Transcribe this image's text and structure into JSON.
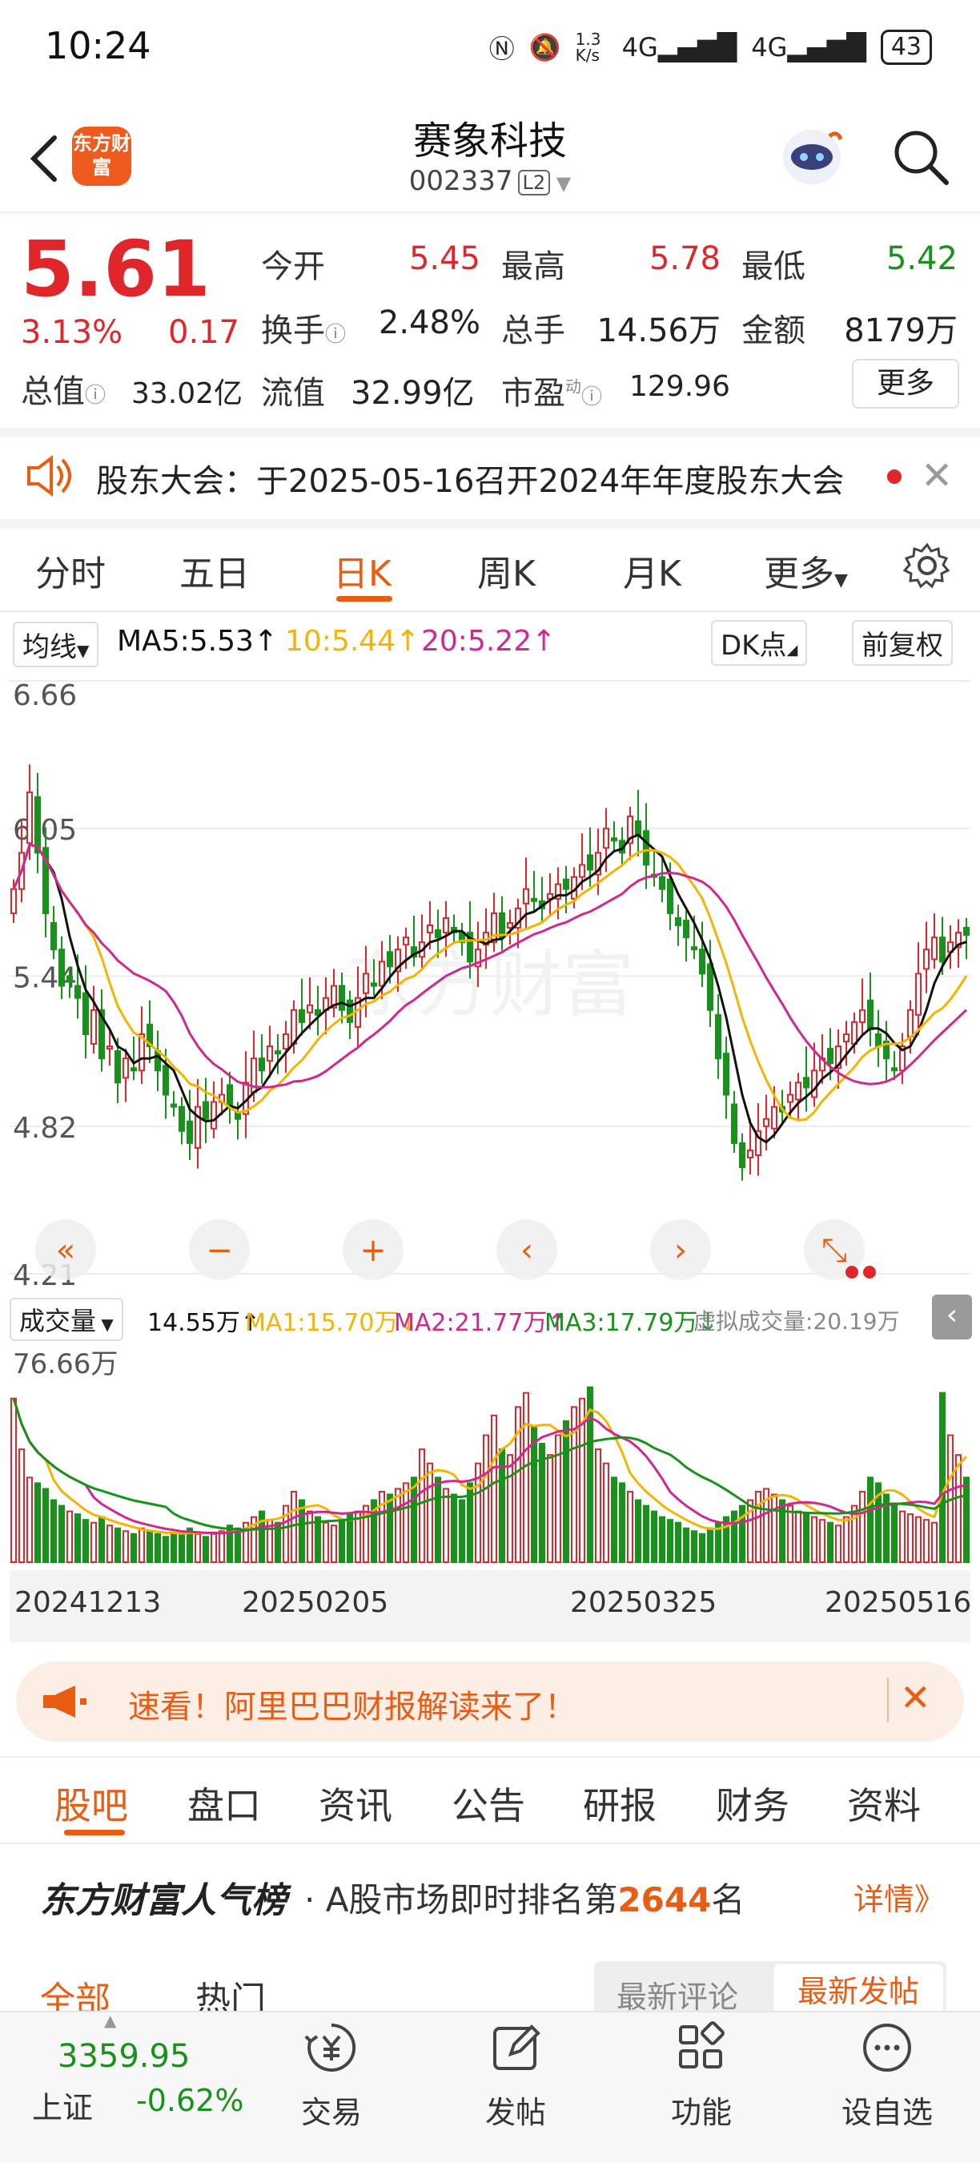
{
  "status_bar": {
    "time": "10:24",
    "net_speed": "1.3 K/s",
    "signal1": "4G",
    "signal2": "4G",
    "battery": "43"
  },
  "header": {
    "logo_text": "东方财富",
    "stock_name": "赛象科技",
    "stock_code": "002337",
    "level_badge": "L2"
  },
  "quote": {
    "price": "5.61",
    "change_pct": "3.13%",
    "change_abs": "0.17",
    "open_label": "今开",
    "open": "5.45",
    "high_label": "最高",
    "high": "5.78",
    "low_label": "最低",
    "low": "5.42",
    "turnover_label": "换手",
    "turnover": "2.48%",
    "volume_label": "总手",
    "volume": "14.56万",
    "amount_label": "金额",
    "amount": "8179万",
    "mktcap_label": "总值",
    "mktcap": "33.02亿",
    "float_label": "流值",
    "float_cap": "32.99亿",
    "pe_label": "市盈",
    "pe_sup": "动",
    "pe": "129.96",
    "more": "更多"
  },
  "notice": {
    "text": "股东大会：于2025-05-16召开2024年年度股东大会"
  },
  "period_tabs": [
    "分时",
    "五日",
    "日K",
    "周K",
    "月K",
    "更多"
  ],
  "ma_bar": {
    "ma_select": "均线",
    "ma5": "MA5:5.53↑",
    "ma10": "10:5.44↑",
    "ma20": "20:5.22↑",
    "dk": "DK点",
    "adjust": "前复权"
  },
  "volume_bar": {
    "select": "成交量",
    "vol": "14.55万↑",
    "ma1": "MA1:15.70万↓",
    "ma2": "MA2:21.77万↑",
    "ma3": "MA3:17.79万↓",
    "virtual": "虚拟成交量:20.19万"
  },
  "chart_data": {
    "type": "candlestick",
    "price_axis_labels": [
      "6.66",
      "6.05",
      "5.44",
      "4.82",
      "4.21"
    ],
    "ylim": [
      4.21,
      6.66
    ],
    "volume_axis_label": "76.66万",
    "volume_ylim": [
      0,
      76.66
    ],
    "date_labels": [
      "20241213",
      "20250205",
      "20250325",
      "20250516"
    ],
    "series_colors": {
      "ma5": "#111111",
      "ma10": "#f5b400",
      "ma20": "#d0288f",
      "up": "#e0262b",
      "down": "#17931b",
      "vol_ma3": "#17931b"
    },
    "closes": [
      5.8,
      5.95,
      6.2,
      5.95,
      5.7,
      5.55,
      5.4,
      5.42,
      5.35,
      5.2,
      5.3,
      5.1,
      5.15,
      5.0,
      5.1,
      5.05,
      5.2,
      5.15,
      5.05,
      4.95,
      4.9,
      4.8,
      4.75,
      4.9,
      4.85,
      4.92,
      4.95,
      4.9,
      4.85,
      5.0,
      5.1,
      5.05,
      5.15,
      5.12,
      5.2,
      5.3,
      5.25,
      5.32,
      5.28,
      5.35,
      5.4,
      5.3,
      5.25,
      5.35,
      5.45,
      5.4,
      5.5,
      5.48,
      5.55,
      5.6,
      5.52,
      5.58,
      5.65,
      5.6,
      5.68,
      5.62,
      5.58,
      5.5,
      5.55,
      5.62,
      5.7,
      5.6,
      5.66,
      5.72,
      5.8,
      5.75,
      5.72,
      5.78,
      5.82,
      5.8,
      5.85,
      5.9,
      5.88,
      5.95,
      6.05,
      6.0,
      5.95,
      6.1,
      6.02,
      5.9,
      5.85,
      5.8,
      5.7,
      5.65,
      5.6,
      5.55,
      5.45,
      5.3,
      5.1,
      4.95,
      4.75,
      4.65,
      4.72,
      4.8,
      4.85,
      4.9,
      4.88,
      4.95,
      5.0,
      4.98,
      5.05,
      5.1,
      5.08,
      5.15,
      5.2,
      5.25,
      5.3,
      5.22,
      5.15,
      5.1,
      5.05,
      5.15,
      5.3,
      5.45,
      5.55,
      5.6,
      5.5,
      5.58,
      5.62,
      5.61
    ],
    "volumes": [
      58,
      40,
      30,
      28,
      26,
      22,
      20,
      18,
      17,
      15,
      14,
      16,
      13,
      12,
      11,
      10,
      12,
      11,
      10,
      9,
      10,
      11,
      12,
      10,
      9,
      10,
      11,
      13,
      12,
      14,
      16,
      18,
      15,
      14,
      20,
      25,
      22,
      18,
      16,
      14,
      13,
      15,
      17,
      18,
      20,
      22,
      25,
      24,
      26,
      28,
      30,
      40,
      35,
      30,
      26,
      24,
      22,
      28,
      35,
      45,
      52,
      40,
      38,
      55,
      60,
      48,
      42,
      38,
      45,
      50,
      55,
      58,
      62,
      40,
      35,
      30,
      28,
      25,
      22,
      20,
      18,
      16,
      15,
      14,
      12,
      11,
      10,
      12,
      14,
      16,
      18,
      20,
      22,
      25,
      26,
      24,
      22,
      20,
      18,
      17,
      16,
      15,
      14,
      13,
      16,
      20,
      25,
      30,
      28,
      24,
      20,
      18,
      17,
      16,
      15,
      14,
      60,
      45,
      38,
      30
    ]
  },
  "chart_controls": [
    "«",
    "−",
    "+",
    "‹",
    "›",
    "⤡"
  ],
  "banner": {
    "text": "速看！阿里巴巴财报解读来了！"
  },
  "content_tabs": [
    "股吧",
    "盘口",
    "资讯",
    "公告",
    "研报",
    "财务",
    "资料"
  ],
  "popularity": {
    "title": "东方财富人气榜",
    "text_prefix": "· A股市场即时排名第",
    "rank": "2644",
    "text_suffix": "名",
    "detail": "详情》"
  },
  "feed_tabs": {
    "all": "全部",
    "hot": "热门",
    "latest_comment": "最新评论",
    "latest_post": "最新发帖"
  },
  "bottom_nav": {
    "index_value": "3359.95",
    "index_name": "上证",
    "index_change": "-0.62%",
    "items": [
      "交易",
      "发帖",
      "功能",
      "设自选"
    ]
  }
}
